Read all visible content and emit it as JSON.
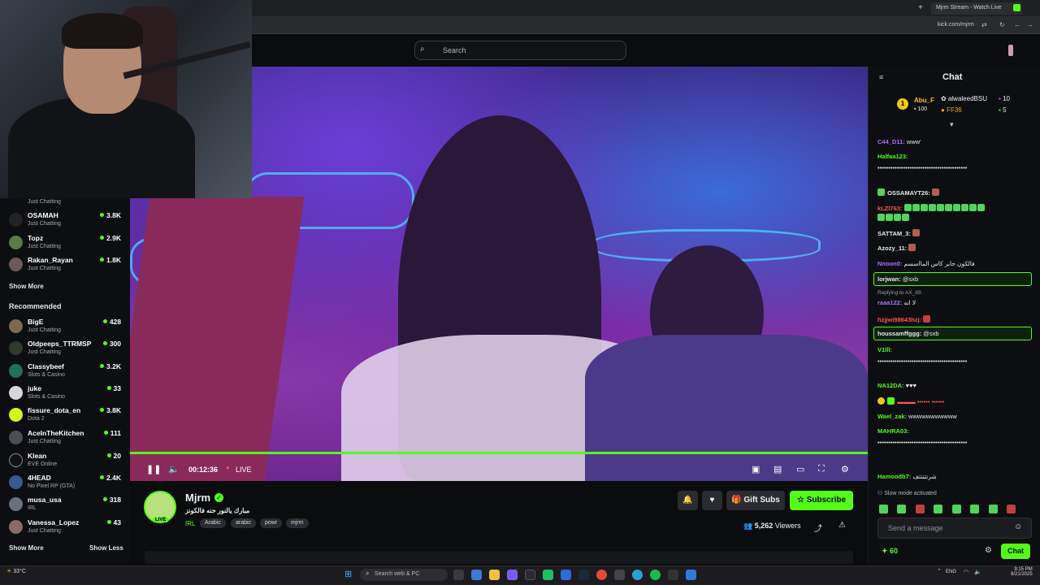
{
  "browser": {
    "tab_title": "Mjrm Stream - Watch Live",
    "url": "kick.com/mjrm"
  },
  "header": {
    "search_placeholder": "Search"
  },
  "sidebar": {
    "partial_top_category": "Just Chatting",
    "following": [
      {
        "name": "OSAMAH",
        "category": "Just Chatting",
        "viewers": "3.8K"
      },
      {
        "name": "Topz",
        "category": "Just Chatting",
        "viewers": "2.9K"
      },
      {
        "name": "Rakan_Rayan",
        "category": "Just Chatting",
        "viewers": "1.8K"
      }
    ],
    "show_more": "Show More",
    "recommended_title": "Recommended",
    "recommended": [
      {
        "name": "BigE",
        "category": "Just Chatting",
        "viewers": "428"
      },
      {
        "name": "Oldpeeps_TTRMSP",
        "category": "Just Chatting",
        "viewers": "300"
      },
      {
        "name": "Classybeef",
        "category": "Slots & Casino",
        "viewers": "3.2K"
      },
      {
        "name": "juke",
        "category": "Slots & Casino",
        "viewers": "33"
      },
      {
        "name": "fissure_dota_en",
        "category": "Dota 2",
        "viewers": "3.8K"
      },
      {
        "name": "AceInTheKitchen",
        "category": "Just Chatting",
        "viewers": "111"
      },
      {
        "name": "Klean",
        "category": "EVE Online",
        "viewers": "20"
      },
      {
        "name": "4HEAD",
        "category": "No Pixel RP (GTA)",
        "viewers": "2.4K"
      },
      {
        "name": "musa_usa",
        "category": "IRL",
        "viewers": "318"
      },
      {
        "name": "Vanessa_Lopez",
        "category": "Just Chatting",
        "viewers": "43"
      }
    ],
    "show_more_bottom": "Show More",
    "show_less": "Show Less"
  },
  "player": {
    "time": "00:12:36",
    "live_label": "LIVE"
  },
  "channel": {
    "name": "Mjrm",
    "title": "مبارك يالنور حنه فالكونز",
    "badge": "LIVE",
    "category": "IRL",
    "tags": [
      "Arabic",
      "arabic",
      "powr",
      "mjrm"
    ],
    "gift_label": "Gift Subs",
    "subscribe_label": "Subscribe",
    "viewers": "5,262",
    "viewers_label": "Viewers"
  },
  "chat": {
    "title": "Chat",
    "leaderboard": [
      {
        "name": "Abu_F",
        "value": "100",
        "rank": "1"
      },
      {
        "name": "alwaleedBSU",
        "value": "10"
      },
      {
        "name": "FF36",
        "value": "5"
      }
    ],
    "messages": [
      {
        "user": "C44_D11:",
        "text": "www'",
        "color": "#a970ff"
      },
      {
        "user": "Halfaa123:",
        "text": "",
        "color": "#53fc18"
      },
      {
        "user": "",
        "text": "••••••••••••••••••••••••••••••••••••••••••",
        "color": "#e7e8ea"
      },
      {
        "user": "OSSAMAYT26:",
        "text": "",
        "color": "#e7e8ea"
      },
      {
        "user": "kLZI763:",
        "text": "",
        "color": "#ff5555"
      },
      {
        "user": "SATTAM_3:",
        "text": "",
        "color": "#e7e8ea"
      },
      {
        "user": "Azozy_11:",
        "text": "",
        "color": "#e7e8ea"
      },
      {
        "user": "Nnoon0:",
        "text": "فالكون جاير كاس المااسسم",
        "color": "#a970ff"
      },
      {
        "user": "lorjwan:",
        "text": "@sxb",
        "color": "#e7e8ea"
      },
      {
        "user": "raaa122:",
        "text": "لا انه",
        "color": "#a970ff"
      },
      {
        "user": "hzjjwi98643hzj:",
        "text": "",
        "color": "#ff5555"
      },
      {
        "user": "houssamffggg:",
        "text": "@sxb",
        "color": "#e7e8ea"
      },
      {
        "user": "V1lll:",
        "text": "",
        "color": "#53fc18"
      },
      {
        "user": "",
        "text": "••••••••••••••••••••••••••••••••••••••••••",
        "color": "#e7e8ea"
      },
      {
        "user": "NA12DA:",
        "text": "♥♥♥",
        "color": "#53fc18"
      },
      {
        "user": "Wael_zak:",
        "text": "wwwwwwwwwww",
        "color": "#53fc18"
      },
      {
        "user": "MAHRA03:",
        "text": "",
        "color": "#53fc18"
      },
      {
        "user": "",
        "text": "••••••••••••••••••••••••••••••••••••••••••",
        "color": "#e7e8ea"
      },
      {
        "user": "Hamoodb7:",
        "text": "شرتتتتتف",
        "color": "#53fc18"
      }
    ],
    "reply_note": "Replying to AX_89:",
    "slow_mode": "Slow mode activated",
    "input_placeholder": "Send a message",
    "points": "60",
    "send_label": "Chat"
  },
  "taskbar": {
    "weather": "33°C",
    "search_placeholder": "Search web & PC",
    "lang": "ENG",
    "time": "9:15 PM",
    "date": "8/21/2025"
  },
  "colors": {
    "accent": "#53fc18",
    "background": "#0b0c0e"
  }
}
